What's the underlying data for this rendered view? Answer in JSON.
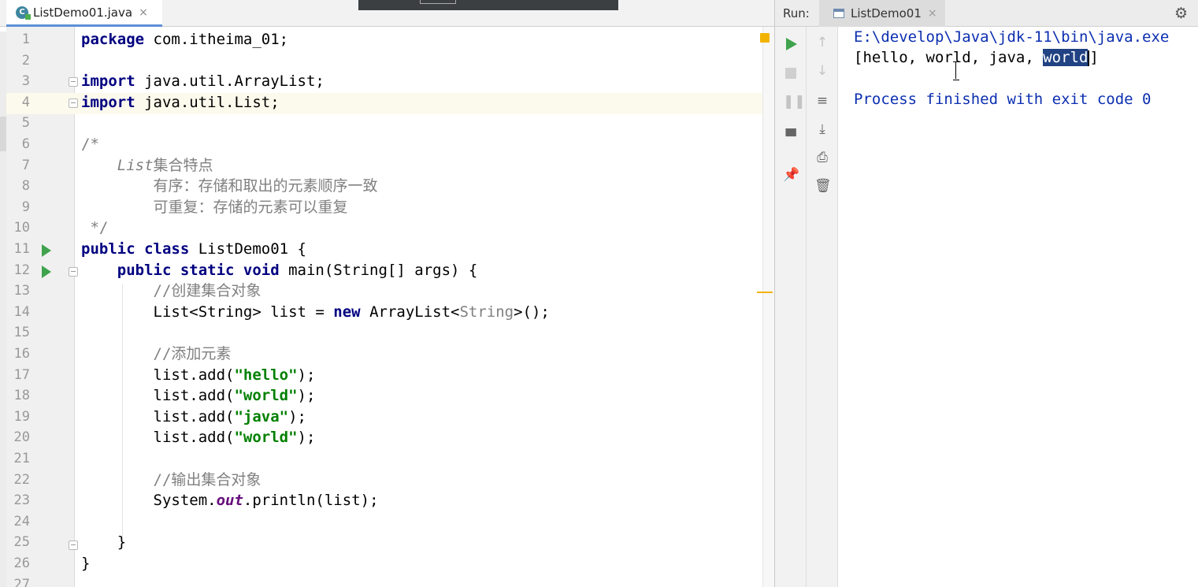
{
  "editor": {
    "tab": {
      "label": "ListDemo01.java",
      "icon_letter": "C",
      "close": "×"
    },
    "lines": [
      {
        "n": "1",
        "parts": [
          {
            "c": "kw",
            "t": "package"
          },
          {
            "c": "",
            "t": " com.itheima_01;"
          }
        ]
      },
      {
        "n": "2",
        "parts": []
      },
      {
        "n": "3",
        "parts": [
          {
            "c": "kw",
            "t": "import"
          },
          {
            "c": "",
            "t": " java.util.ArrayList;"
          }
        ]
      },
      {
        "n": "4",
        "parts": [
          {
            "c": "kw",
            "t": "import"
          },
          {
            "c": "",
            "t": " java.util.List;"
          }
        ]
      },
      {
        "n": "5",
        "parts": []
      },
      {
        "n": "6",
        "parts": [
          {
            "c": "cm",
            "t": "/*"
          }
        ]
      },
      {
        "n": "7",
        "parts": [
          {
            "c": "cmi",
            "t": "    List"
          },
          {
            "c": "cm",
            "t": "集合特点"
          }
        ]
      },
      {
        "n": "8",
        "parts": [
          {
            "c": "cm",
            "t": "        有序：存储和取出的元素顺序一致"
          }
        ]
      },
      {
        "n": "9",
        "parts": [
          {
            "c": "cm",
            "t": "        可重复：存储的元素可以重复"
          }
        ]
      },
      {
        "n": "10",
        "parts": [
          {
            "c": "cm",
            "t": " */"
          }
        ]
      },
      {
        "n": "11",
        "parts": [
          {
            "c": "kw",
            "t": "public class"
          },
          {
            "c": "",
            "t": " ListDemo01 {"
          }
        ]
      },
      {
        "n": "12",
        "parts": [
          {
            "c": "",
            "t": "    "
          },
          {
            "c": "kw",
            "t": "public static void"
          },
          {
            "c": "",
            "t": " main(String[] args) {"
          }
        ]
      },
      {
        "n": "13",
        "parts": [
          {
            "c": "cm",
            "t": "        //创建集合对象"
          }
        ]
      },
      {
        "n": "14",
        "parts": [
          {
            "c": "",
            "t": "        List<String> list = "
          },
          {
            "c": "kw",
            "t": "new"
          },
          {
            "c": "",
            "t": " ArrayList<"
          },
          {
            "c": "tp",
            "t": "String"
          },
          {
            "c": "",
            "t": ">();"
          }
        ]
      },
      {
        "n": "15",
        "parts": []
      },
      {
        "n": "16",
        "parts": [
          {
            "c": "cm",
            "t": "        //添加元素"
          }
        ]
      },
      {
        "n": "17",
        "parts": [
          {
            "c": "",
            "t": "        list.add("
          },
          {
            "c": "str",
            "t": "\"hello\""
          },
          {
            "c": "",
            "t": ");"
          }
        ]
      },
      {
        "n": "18",
        "parts": [
          {
            "c": "",
            "t": "        list.add("
          },
          {
            "c": "str",
            "t": "\"world\""
          },
          {
            "c": "",
            "t": ");"
          }
        ]
      },
      {
        "n": "19",
        "parts": [
          {
            "c": "",
            "t": "        list.add("
          },
          {
            "c": "str",
            "t": "\"java\""
          },
          {
            "c": "",
            "t": ");"
          }
        ]
      },
      {
        "n": "20",
        "parts": [
          {
            "c": "",
            "t": "        list.add("
          },
          {
            "c": "str",
            "t": "\"world\""
          },
          {
            "c": "",
            "t": ");"
          }
        ]
      },
      {
        "n": "21",
        "parts": []
      },
      {
        "n": "22",
        "parts": [
          {
            "c": "cm",
            "t": "        //输出集合对象"
          }
        ]
      },
      {
        "n": "23",
        "parts": [
          {
            "c": "",
            "t": "        System."
          },
          {
            "c": "sf",
            "t": "out"
          },
          {
            "c": "",
            "t": ".println(list);"
          }
        ]
      },
      {
        "n": "24",
        "parts": []
      },
      {
        "n": "25",
        "parts": [
          {
            "c": "",
            "t": "    }"
          }
        ]
      },
      {
        "n": "26",
        "parts": [
          {
            "c": "",
            "t": "}"
          }
        ]
      },
      {
        "n": "27",
        "parts": []
      }
    ]
  },
  "run": {
    "title": "Run:",
    "tab_label": "ListDemo01",
    "tab_close": "×",
    "console": {
      "path": "E:\\develop\\Java\\jdk-11\\bin\\java.exe",
      "output_prefix": "[hello, world, java, ",
      "output_selected": "world",
      "output_suffix": "]",
      "finished": "Process finished with exit code 0"
    }
  },
  "colors": {
    "keyword": "#000080",
    "string": "#008000",
    "comment": "#808080",
    "console_info": "#0c2fb0",
    "selection": "#214283",
    "run_green": "#3fa34d"
  }
}
